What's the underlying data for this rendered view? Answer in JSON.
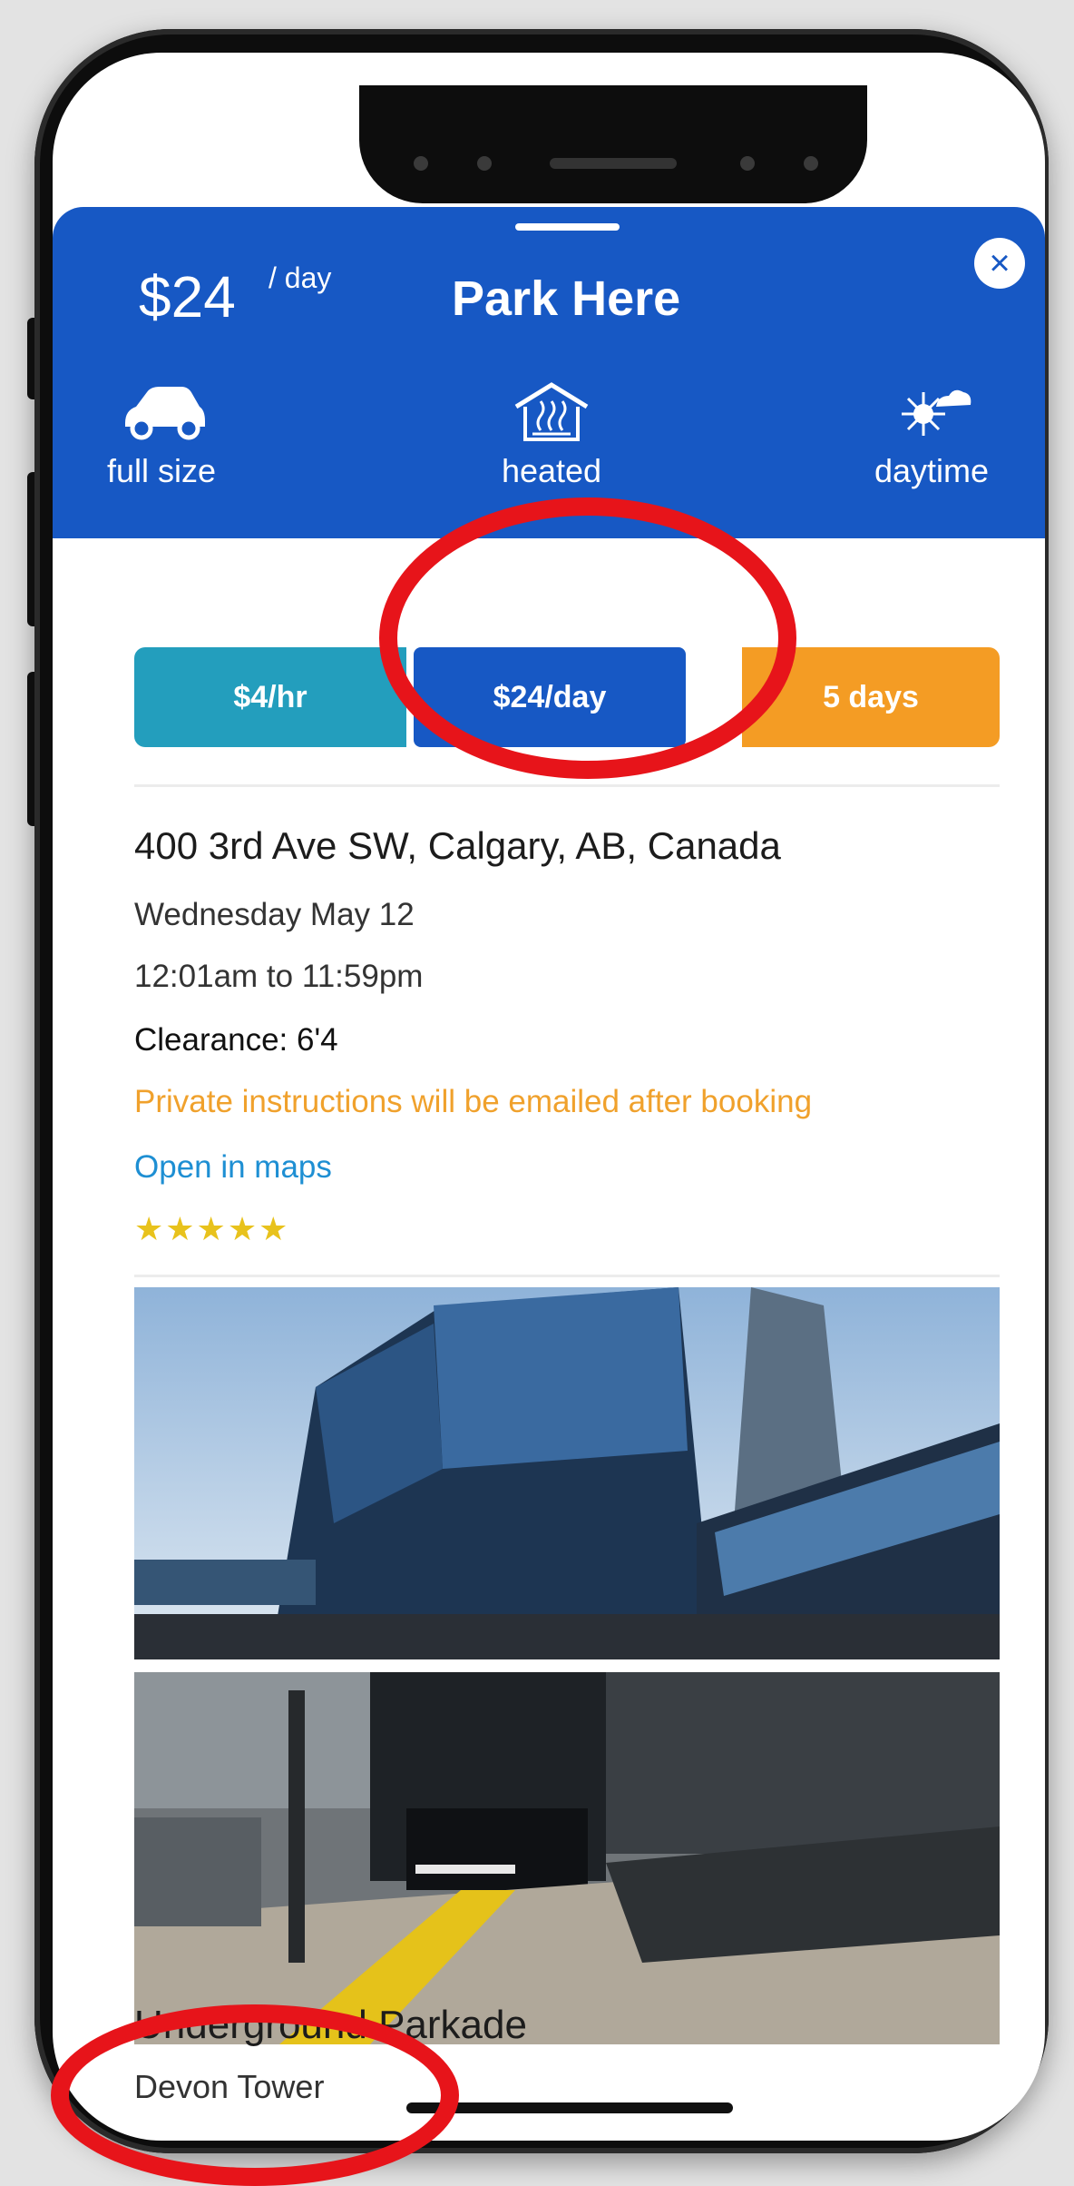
{
  "header": {
    "price": "$24",
    "price_unit": "/ day",
    "title": "Park Here",
    "close_icon": "×",
    "features": [
      {
        "icon": "car-icon",
        "label": "full size"
      },
      {
        "icon": "heated-garage-icon",
        "label": "heated"
      },
      {
        "icon": "sun-cloud-icon",
        "label": "daytime"
      }
    ]
  },
  "rate_tabs": [
    {
      "label": "$4/hr",
      "color": "#239ebd"
    },
    {
      "label": "$24/day",
      "color": "#1758c4",
      "selected": true
    },
    {
      "label": "5 days",
      "color": "#f49c24"
    }
  ],
  "details": {
    "address": "400 3rd Ave SW, Calgary, AB, Canada",
    "date": "Wednesday May 12",
    "time": "12:01am to 11:59pm",
    "clearance": "Clearance: 6'4",
    "instructions": "Private instructions will be emailed after booking",
    "maps_link": "Open in maps",
    "rating_stars": "★★★★★"
  },
  "location": {
    "caption": "Underground Parkade",
    "name": "Devon Tower"
  },
  "colors": {
    "brand_blue": "#1758c4",
    "teal": "#239ebd",
    "orange": "#f49c24",
    "annotation_red": "#e7141a"
  }
}
